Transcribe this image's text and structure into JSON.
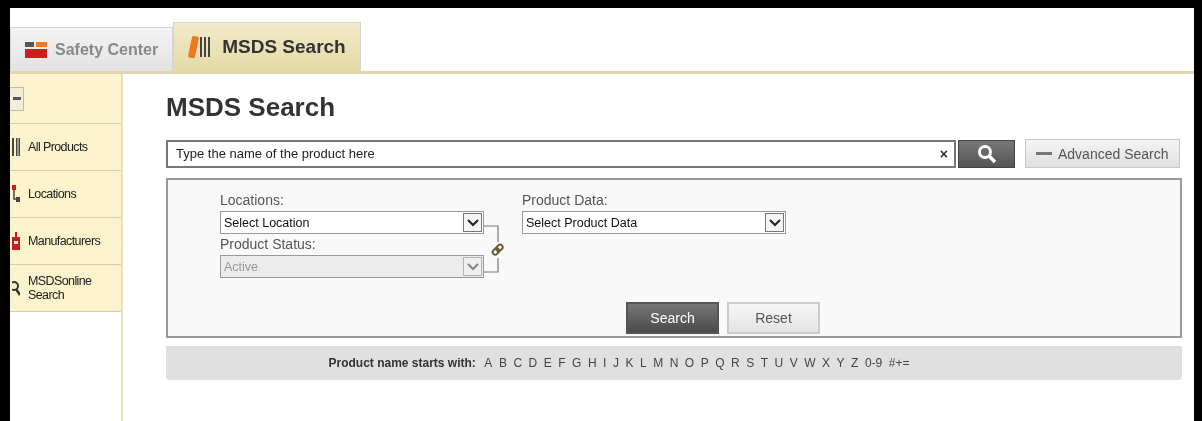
{
  "tabs": [
    {
      "label": "Safety Center",
      "selected": false,
      "kind": "safety"
    },
    {
      "label": "MSDS Search",
      "selected": true,
      "kind": "msds"
    }
  ],
  "sidebar": {
    "items": [
      {
        "label": "All Products",
        "kind": "barcode"
      },
      {
        "label": "Locations",
        "kind": "locations"
      },
      {
        "label": "Manufacturers",
        "kind": "manufacturers"
      },
      {
        "label": "MSDSonline Search",
        "kind": "search"
      }
    ]
  },
  "page_title": "MSDS Search",
  "search": {
    "value": "Type the name of the product here",
    "clear": "×"
  },
  "advanced_search": {
    "label": "Advanced Search",
    "expanded": true
  },
  "filters": {
    "locations": {
      "label": "Locations:",
      "value": "Select Location",
      "disabled": false
    },
    "product_status": {
      "label": "Product Status:",
      "value": "Active",
      "disabled": true
    },
    "product_data": {
      "label": "Product Data:",
      "value": "Select Product Data",
      "disabled": false
    },
    "buttons": [
      {
        "label": "Search",
        "kind": "primary"
      },
      {
        "label": "Reset",
        "kind": "secondary"
      }
    ]
  },
  "alphabet": {
    "label": "Product name starts with:",
    "letters": [
      "A",
      "B",
      "C",
      "D",
      "E",
      "F",
      "G",
      "H",
      "I",
      "J",
      "K",
      "L",
      "M",
      "N",
      "O",
      "P",
      "Q",
      "R",
      "S",
      "T",
      "U",
      "V",
      "W",
      "X",
      "Y",
      "Z",
      "0-9",
      "#+="
    ]
  }
}
